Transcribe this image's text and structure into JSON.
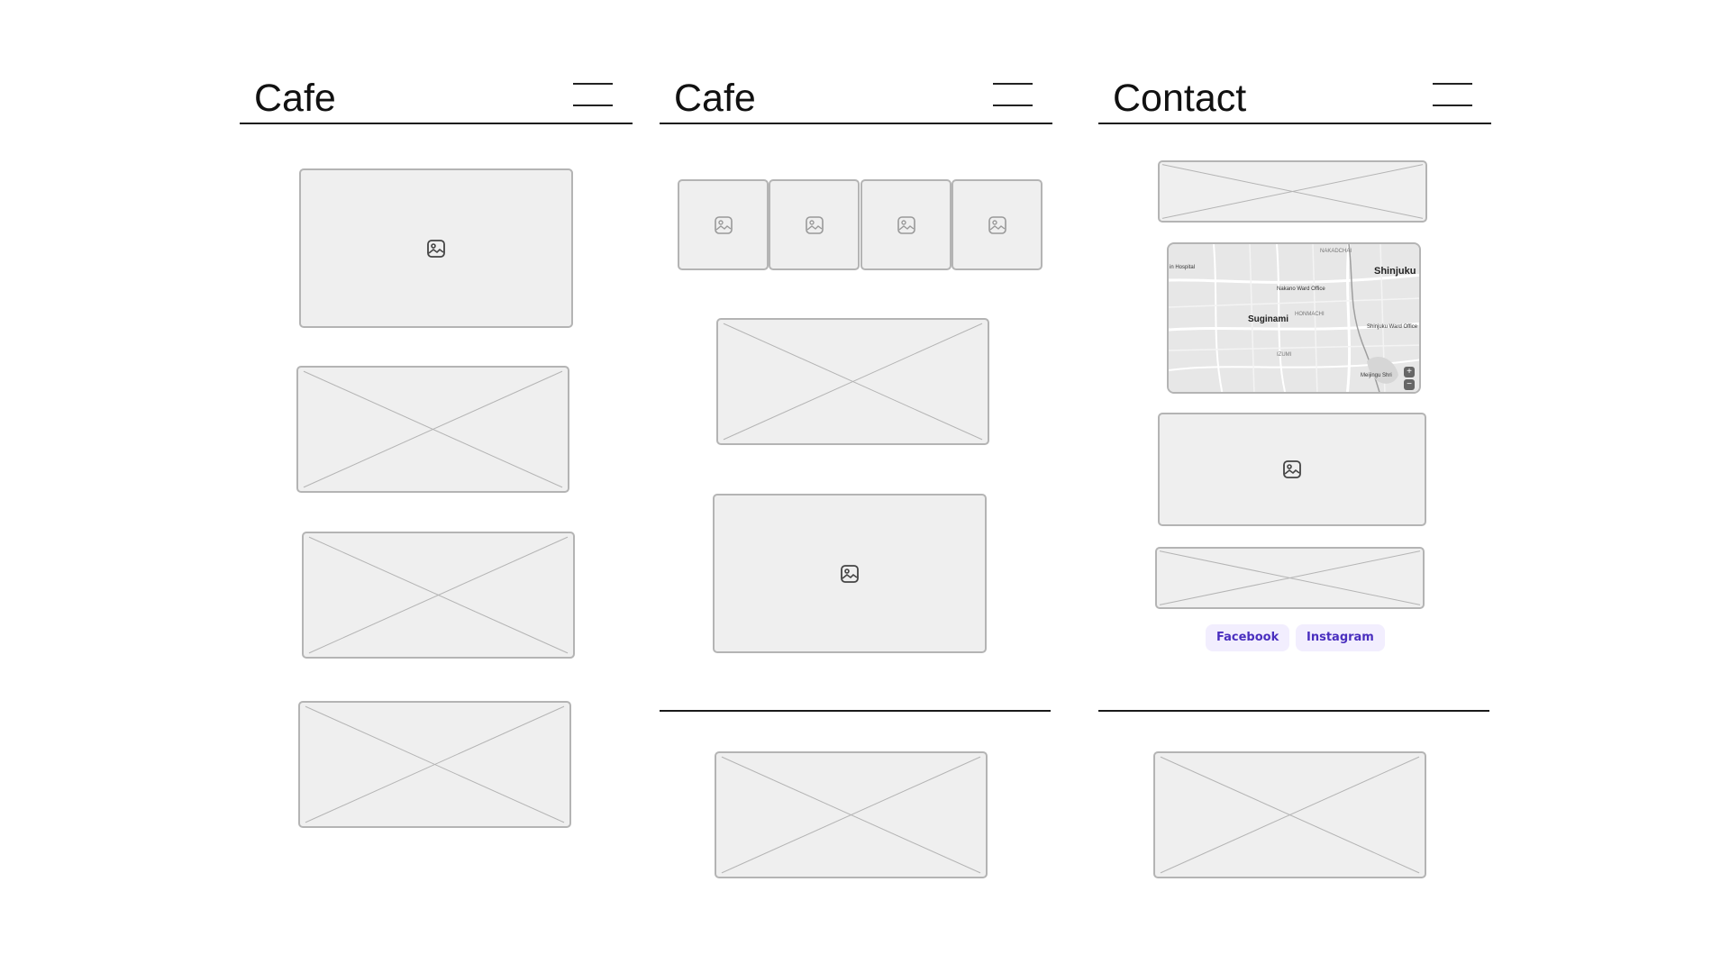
{
  "columns": [
    {
      "title": "Cafe"
    },
    {
      "title": "Cafe"
    },
    {
      "title": "Contact"
    }
  ],
  "map": {
    "labels": {
      "shinjuku": "Shinjuku",
      "suginami": "Suginami",
      "nakano_ward_office": "Nakano Ward Office",
      "shinjuku_ward_office": "Shinjuku Ward Office",
      "nakadchai": "NAKADCHAI",
      "honmachi": "HONMACHI",
      "izumi": "IZUMI",
      "hospital": "in Hospital",
      "meiji": "Meijingu Shri"
    },
    "zoom_in": "+",
    "zoom_out": "−"
  },
  "social": {
    "facebook": "Facebook",
    "instagram": "Instagram"
  },
  "icons": {
    "menu": "hamburger-menu-icon",
    "image": "image-placeholder-icon",
    "placeholder": "x-placeholder"
  },
  "colors": {
    "placeholder_fill": "#efefef",
    "placeholder_stroke": "#b4b4b4",
    "link_text": "#4a2fbf",
    "link_bg": "#f2eefe"
  }
}
